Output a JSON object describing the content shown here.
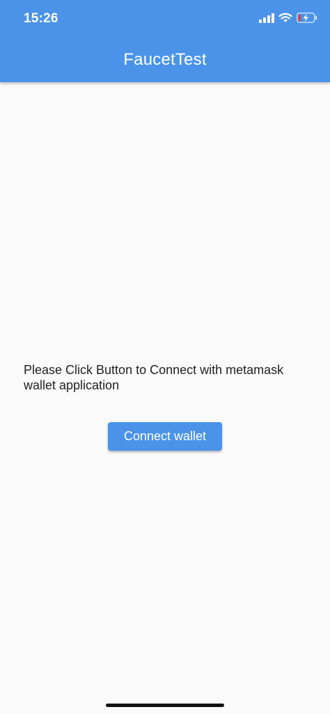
{
  "status_bar": {
    "time": "15:26",
    "icons": [
      "cellular-signal-icon",
      "wifi-icon",
      "battery-charging-icon"
    ],
    "battery_level_fraction": 0.15
  },
  "app_bar": {
    "title": "FaucetTest"
  },
  "main": {
    "message": "Please Click Button to Connect with metamask wallet application",
    "connect_button_label": "Connect wallet"
  },
  "colors": {
    "primary": "#4a93e8",
    "background": "#fafafa",
    "text": "#1f1f1f",
    "battery_low": "#e53935"
  }
}
